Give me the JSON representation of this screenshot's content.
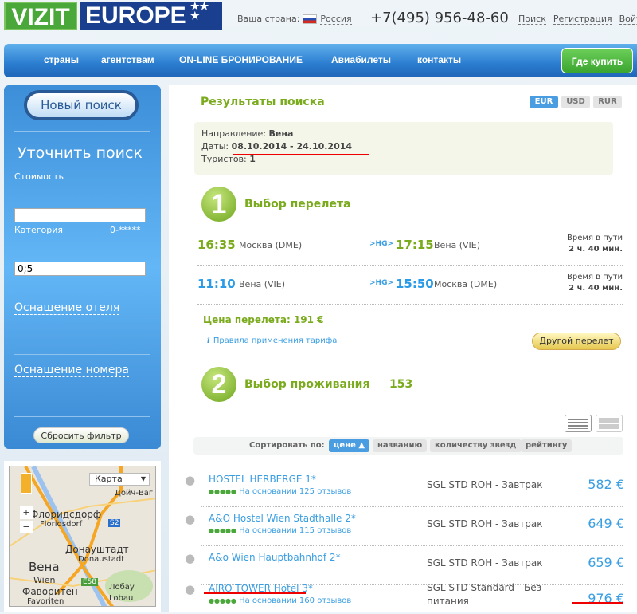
{
  "header": {
    "logo_left": "VIZIT",
    "logo_right": "EUROPE",
    "country_label": "Ваша страна:",
    "country": "Россия",
    "phone": "+7(495) 956-48-60",
    "links": [
      "Поиск",
      "Регистрация",
      "Войти"
    ]
  },
  "nav": {
    "items": [
      "страны",
      "агентствам",
      "ON-LINE БРОНИРОВАНИЕ",
      "Авиабилеты",
      "контакты"
    ],
    "buy": "Где купить"
  },
  "sidebar": {
    "new_search": "Новый поиск",
    "refine": "Уточнить поиск",
    "cost_label": "Стоимость",
    "cost_value": "",
    "category_label": "Категория",
    "category_range": "0-*****",
    "category_value": "0;5",
    "hotel_amenities": "Оснащение отеля",
    "room_amenities": "Оснащение номера",
    "reset": "Сбросить фильтр"
  },
  "map": {
    "type": "Карта",
    "zoom_in": "+",
    "zoom_out": "−",
    "labels": [
      "Флоридсдорф",
      "Floridsdorf",
      "Донауштадт",
      "Donaustadt",
      "Вена",
      "Wien",
      "Фаворитен",
      "Favoriten",
      "Лобау",
      "Lobau",
      "Дойч-Ваг",
      "S2",
      "E58"
    ]
  },
  "results": {
    "title": "Результаты поиска",
    "currencies": [
      "EUR",
      "USD",
      "RUR"
    ],
    "active_currency": "EUR",
    "direction_label": "Направление:",
    "direction": "Вена",
    "dates_label": "Даты:",
    "dates": "08.10.2014 - 24.10.2014",
    "tourists_label": "Туристов:",
    "tourists": "1"
  },
  "flights": {
    "step": "1",
    "title": "Выбор перелета",
    "legs": [
      {
        "dep_time": "16:35",
        "dep": "Москва (DME)",
        "airline": "HG",
        "arr_time": "17:15",
        "arr": "Вена (VIE)",
        "dur_label": "Время в пути",
        "dur": "2 ч. 40 мин."
      },
      {
        "dep_time": "11:10",
        "dep": "Вена (VIE)",
        "airline": "HG",
        "arr_time": "15:50",
        "arr": "Москва (DME)",
        "dur_label": "Время в пути",
        "dur": "2 ч. 40 мин."
      }
    ],
    "price": "Цена перелета: 191 €",
    "rules": "Правила применения тарифа",
    "other": "Другой перелет"
  },
  "hotels": {
    "step": "2",
    "title": "Выбор проживания",
    "count": "153",
    "sort_label": "Сортировать по:",
    "sort": [
      "цене",
      "названию",
      "количеству звезд",
      "рейтингу"
    ],
    "active_sort": "цене",
    "items": [
      {
        "name": "HOSTEL HERBERGE 1*",
        "reviews": "На основании 125 отзывов",
        "room": "SGL STD ROH - Завтрак",
        "price": "582 €"
      },
      {
        "name": "A&O Hostel Wien Stadthalle 2*",
        "reviews": "На основании 115 отзывов",
        "room": "SGL STD ROH - Завтрак",
        "price": "649 €"
      },
      {
        "name": "A&o Wien Hauptbahnhof 2*",
        "reviews": "",
        "room": "SGL STD ROH - Завтрак",
        "price": "659 €"
      },
      {
        "name": "AIRO TOWER Hotel 3*",
        "reviews": "На основании 160 отзывов",
        "room": "SGL STD Standard - Без питания",
        "price": "976 €"
      }
    ]
  }
}
